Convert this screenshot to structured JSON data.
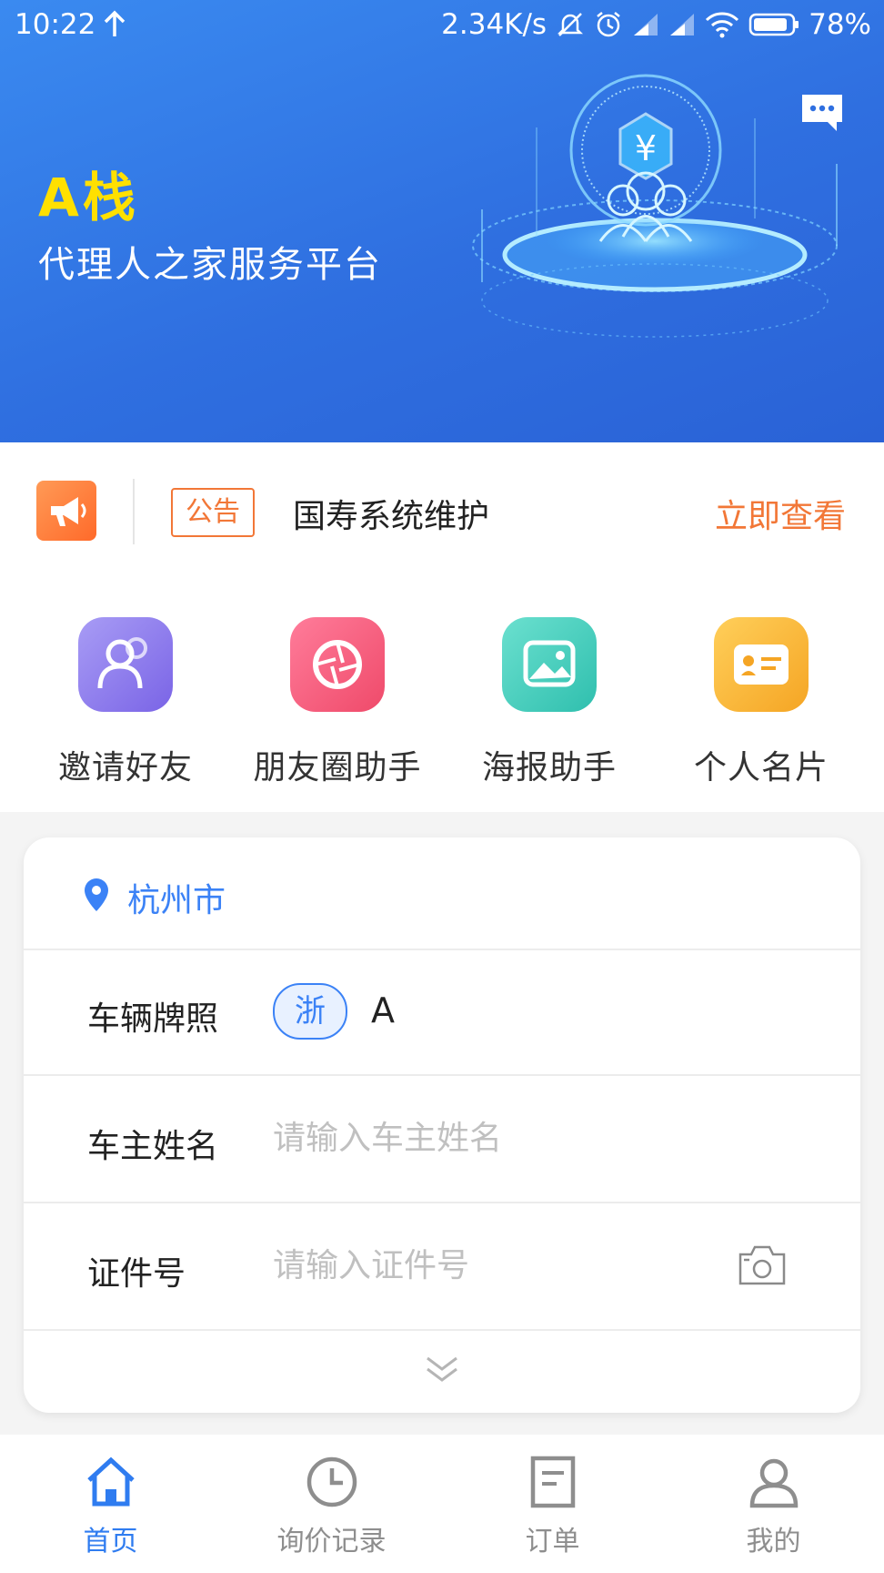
{
  "status_bar": {
    "time": "10:22",
    "network_speed": "2.34K/s",
    "battery": "78%"
  },
  "header": {
    "brand_title": "A栈",
    "subtitle": "代理人之家服务平台"
  },
  "notice": {
    "tag": "公告",
    "text": "国寿系统维护",
    "action": "立即查看"
  },
  "quick_actions": [
    {
      "label": "邀请好友",
      "icon": "invite-friends-icon"
    },
    {
      "label": "朋友圈助手",
      "icon": "moments-assistant-icon"
    },
    {
      "label": "海报助手",
      "icon": "poster-assistant-icon"
    },
    {
      "label": "个人名片",
      "icon": "business-card-icon"
    }
  ],
  "form": {
    "city": "杭州市",
    "plate": {
      "label": "车辆牌照",
      "province": "浙",
      "value": "A"
    },
    "owner": {
      "label": "车主姓名",
      "placeholder": "请输入车主姓名"
    },
    "id_number": {
      "label": "证件号",
      "placeholder": "请输入证件号"
    }
  },
  "tabbar": [
    {
      "label": "首页",
      "icon": "home-icon",
      "active": true
    },
    {
      "label": "询价记录",
      "icon": "clock-icon",
      "active": false
    },
    {
      "label": "订单",
      "icon": "order-icon",
      "active": false
    },
    {
      "label": "我的",
      "icon": "user-icon",
      "active": false
    }
  ],
  "colors": {
    "primary": "#2f7cf0",
    "accent_orange": "#f27737",
    "brand_yellow": "#ffe000"
  }
}
